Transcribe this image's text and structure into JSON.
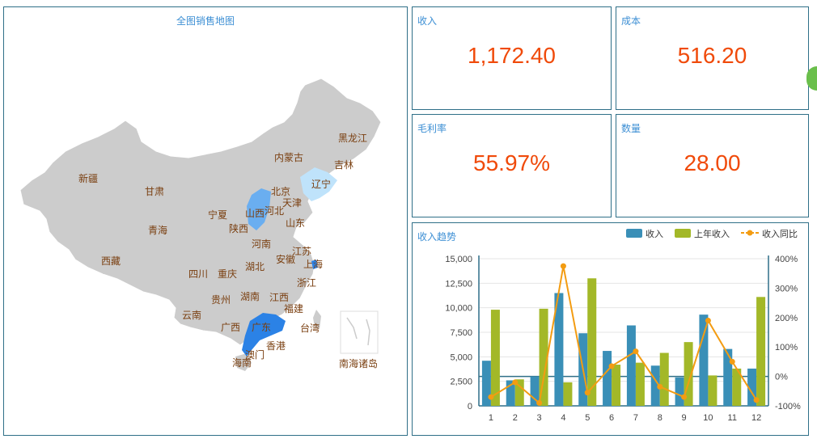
{
  "map": {
    "title": "全图销售地图",
    "provinces": [
      "黑龙江",
      "吉林",
      "内蒙古",
      "辽宁",
      "新疆",
      "甘肃",
      "北京",
      "天津",
      "河北",
      "山西",
      "宁夏",
      "青海",
      "陕西",
      "山东",
      "河南",
      "江苏",
      "安徽",
      "上海",
      "西藏",
      "四川",
      "重庆",
      "湖北",
      "浙江",
      "贵州",
      "湖南",
      "江西",
      "福建",
      "云南",
      "广西",
      "广东",
      "台湾",
      "香港",
      "澳门",
      "海南"
    ],
    "inset_label": "南海诸岛"
  },
  "kpis": [
    {
      "label": "收入",
      "value": "1,172.40"
    },
    {
      "label": "成本",
      "value": "516.20"
    },
    {
      "label": "毛利率",
      "value": "55.97%"
    },
    {
      "label": "数量",
      "value": "28.00"
    }
  ],
  "colors": {
    "accent": "#3d8fd4",
    "value": "#f04a0a",
    "border": "#2f6f88",
    "bar1": "#3a8fb7",
    "bar2": "#a3b828",
    "line": "#f39c12",
    "map_base": "#cccccc",
    "map_high": "#2b82e6",
    "map_mid": "#6aaef0",
    "map_low": "#bfe3fb"
  },
  "chart_title": "收入趋势",
  "chart_data": {
    "type": "bar",
    "title": "收入趋势",
    "categories": [
      "1",
      "2",
      "3",
      "4",
      "5",
      "6",
      "7",
      "8",
      "9",
      "10",
      "11",
      "12"
    ],
    "series": [
      {
        "name": "收入",
        "type": "bar",
        "axis": "left",
        "values": [
          4600,
          2600,
          3000,
          11500,
          7400,
          5600,
          8200,
          4100,
          2900,
          9300,
          5800,
          3800
        ]
      },
      {
        "name": "上年收入",
        "type": "bar",
        "axis": "left",
        "values": [
          9800,
          2700,
          9900,
          2400,
          13000,
          4200,
          4400,
          5400,
          6500,
          3100,
          3800,
          11100
        ]
      },
      {
        "name": "收入同比",
        "type": "line",
        "axis": "right",
        "values": [
          -70,
          -20,
          -90,
          375,
          -55,
          35,
          85,
          -35,
          -70,
          190,
          50,
          -80
        ]
      }
    ],
    "ylim_left": [
      0,
      15000
    ],
    "yticks_left": [
      "0",
      "2,500",
      "5,000",
      "7,500",
      "10,000",
      "12,500",
      "15,000"
    ],
    "ylim_right": [
      -100,
      400
    ],
    "yticks_right": [
      "-100%",
      "0%",
      "100%",
      "200%",
      "300%",
      "400%"
    ],
    "legend_position": "top-right",
    "grid": true
  }
}
